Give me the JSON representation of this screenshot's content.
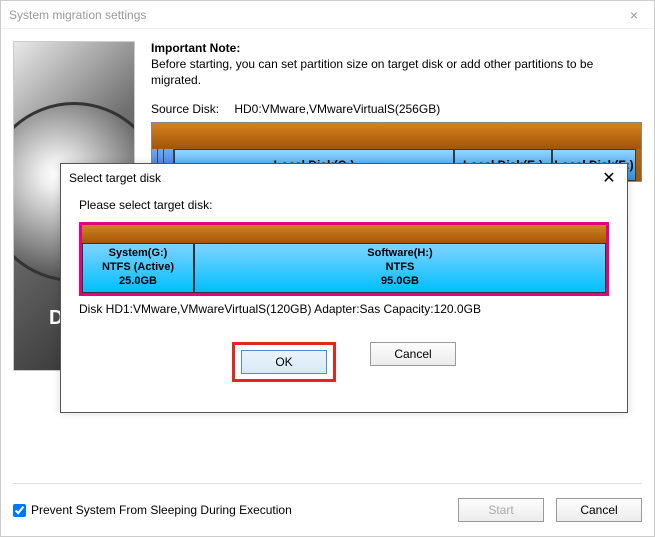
{
  "main": {
    "title": "System migration settings",
    "note": {
      "heading": "Important Note:",
      "body": "Before starting, you can set partition size on target disk or add other partitions to be migrated."
    },
    "source": {
      "label": "Source Disk:",
      "value": "HD0:VMware,VMwareVirtualS(256GB)",
      "partitions": {
        "c": "Local Disk(C:)",
        "e": "Local Disk(E:)",
        "f": "Local Disk(F:)"
      }
    },
    "footer": {
      "checkbox_label": "Prevent System From Sleeping During Execution",
      "checkbox_checked": true,
      "start": "Start",
      "cancel": "Cancel"
    },
    "decor_label": "D"
  },
  "modal": {
    "title": "Select target disk",
    "prompt": "Please select target disk:",
    "partitions": {
      "g": {
        "name": "System(G:)",
        "fs": "NTFS (Active)",
        "size": "25.0GB"
      },
      "h": {
        "name": "Software(H:)",
        "fs": "NTFS",
        "size": "95.0GB"
      }
    },
    "info": "Disk HD1:VMware,VMwareVirtualS(120GB)  Adapter:Sas  Capacity:120.0GB",
    "ok": "OK",
    "cancel": "Cancel"
  }
}
